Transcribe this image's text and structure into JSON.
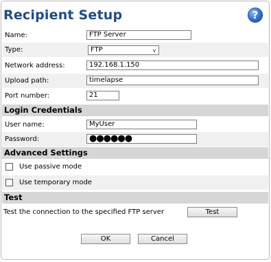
{
  "title": "Recipient Setup",
  "help_label": "?",
  "fields": {
    "name": {
      "label": "Name:",
      "value": "FTP Server"
    },
    "type": {
      "label": "Type:",
      "value": "FTP"
    },
    "network_address": {
      "label": "Network address:",
      "value": "192.168.1.150"
    },
    "upload_path": {
      "label": "Upload path:",
      "value": "timelapse"
    },
    "port_number": {
      "label": "Port number:",
      "value": "21"
    }
  },
  "login": {
    "heading": "Login Credentials",
    "user_name": {
      "label": "User name:",
      "value": "MyUser"
    },
    "password": {
      "label": "Password:",
      "value": "●●●●●●"
    }
  },
  "advanced": {
    "heading": "Advanced Settings",
    "passive_mode": {
      "label": "Use passive mode",
      "checked": false
    },
    "temporary_mode": {
      "label": "Use temporary mode",
      "checked": false
    }
  },
  "test": {
    "heading": "Test",
    "description": "Test the connection to the specified FTP server",
    "button_label": "Test"
  },
  "actions": {
    "ok_label": "OK",
    "cancel_label": "Cancel"
  },
  "colors": {
    "title": "#1c4b8f",
    "section_bg": "#d6d6d6",
    "row_alt_bg": "#f0f0f0"
  }
}
